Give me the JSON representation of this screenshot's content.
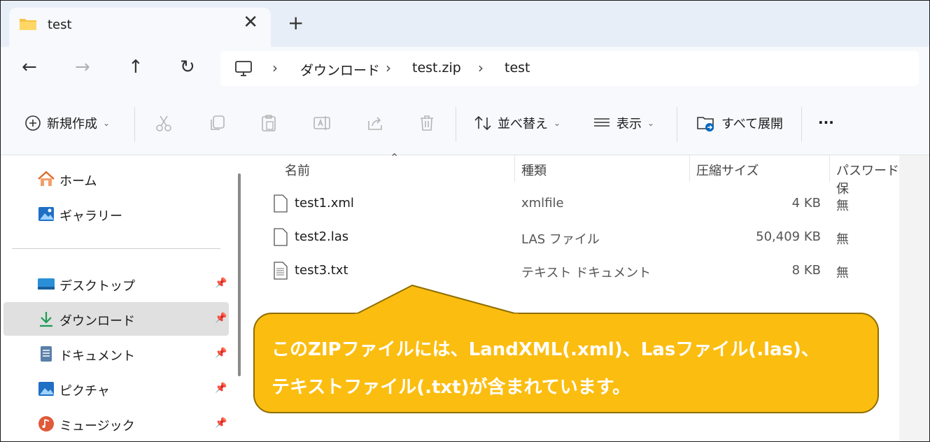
{
  "tab": {
    "title": "test",
    "close": "✕",
    "new": "+"
  },
  "nav": {
    "back": "←",
    "forward": "→",
    "up": "↑",
    "refresh": "↻"
  },
  "breadcrumb": {
    "sep": "›",
    "items": [
      "ダウンロード",
      "test.zip",
      "test"
    ]
  },
  "toolbar": {
    "new_label": "新規作成",
    "sort_label": "並べ替え",
    "view_label": "表示",
    "extract_label": "すべて展開",
    "more_label": "···",
    "chevron": "⌄"
  },
  "sidebar": {
    "items": [
      {
        "label": "ホーム"
      },
      {
        "label": "ギャラリー"
      },
      {
        "label": "デスクトップ"
      },
      {
        "label": "ダウンロード"
      },
      {
        "label": "ドキュメント"
      },
      {
        "label": "ピクチャ"
      },
      {
        "label": "ミュージック"
      }
    ]
  },
  "columns": [
    "名前",
    "種類",
    "圧縮サイズ",
    "パスワード保"
  ],
  "files": [
    {
      "name": "test1.xml",
      "type": "xmlfile",
      "size": "4 KB",
      "password": "無"
    },
    {
      "name": "test2.las",
      "type": "LAS ファイル",
      "size": "50,409 KB",
      "password": "無"
    },
    {
      "name": "test3.txt",
      "type": "テキスト ドキュメント",
      "size": "8 KB",
      "password": "無"
    }
  ],
  "callout": {
    "line1": "このZIPファイルには、LandXML(.xml)、Lasファイル(.las)、",
    "line2": "テキストファイル(.txt)が含まれています。"
  },
  "colors": {
    "callout_fill": "#fbbd10",
    "accent": "#0067c0",
    "folder": "#f6c344"
  }
}
